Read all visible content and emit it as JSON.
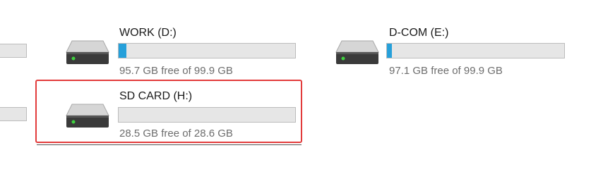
{
  "drives": [
    {
      "name": "WORK (D:)",
      "free_text": "95.7 GB free of 99.9 GB",
      "used_fraction": 0.042,
      "icon": "hard-drive-icon"
    },
    {
      "name": "D-COM (E:)",
      "free_text": "97.1 GB free of 99.9 GB",
      "used_fraction": 0.028,
      "icon": "hard-drive-icon"
    },
    {
      "name": "SD CARD (H:)",
      "free_text": "28.5 GB free of 28.6 GB",
      "used_fraction": 0.0035,
      "icon": "hard-drive-icon"
    }
  ],
  "colors": {
    "usage_fill": "#26a0da",
    "selection_border": "#e23b3b",
    "led": "#3ed23e"
  }
}
